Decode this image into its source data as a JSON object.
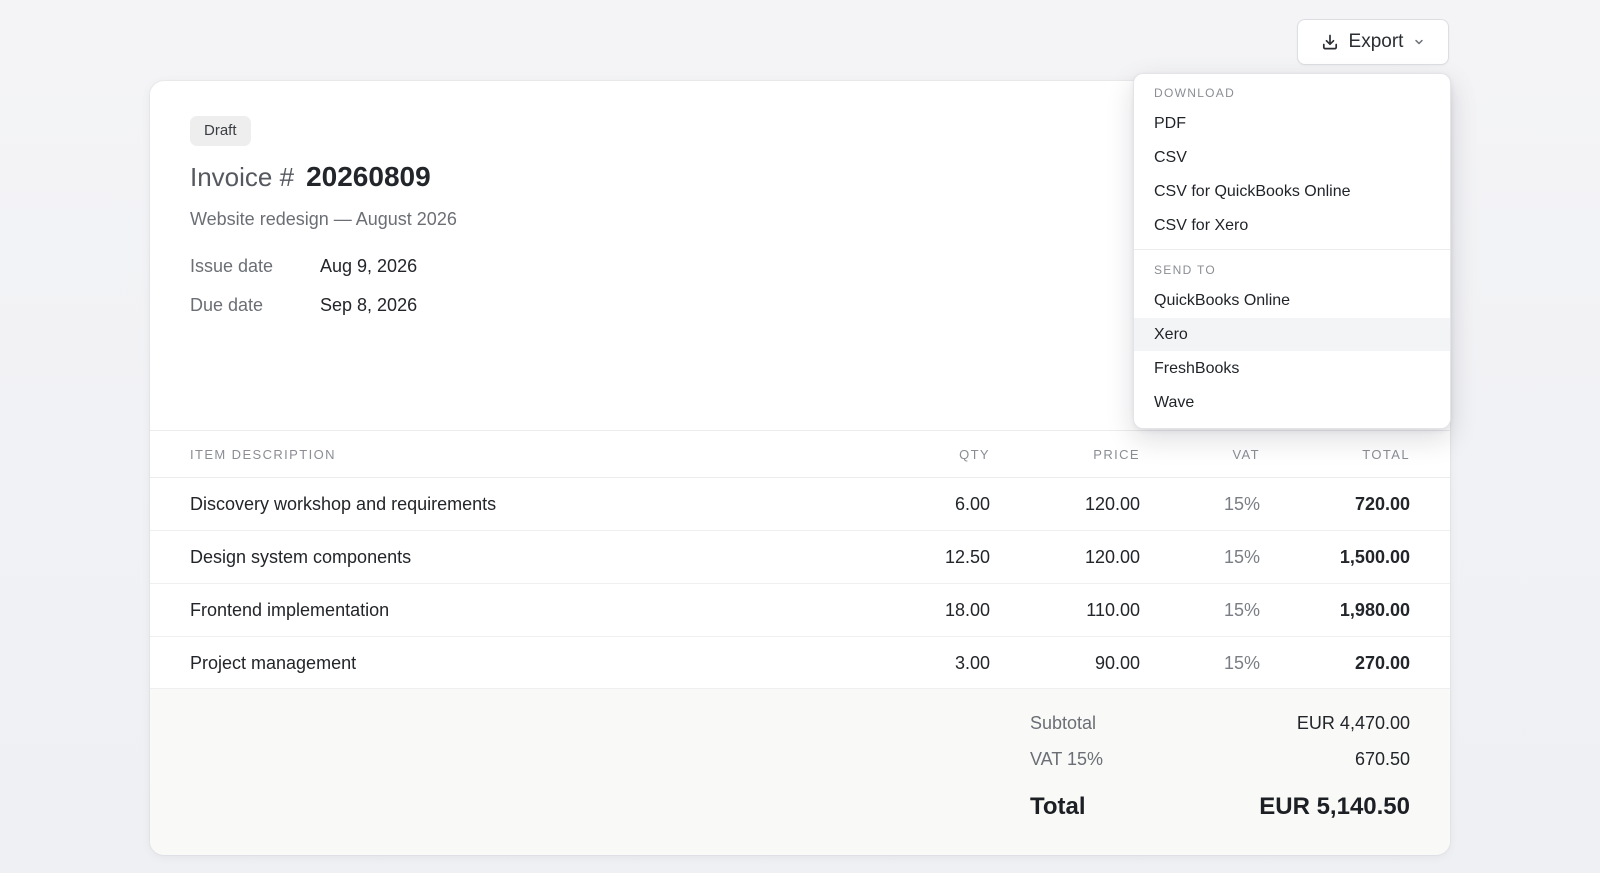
{
  "export_button": {
    "label": "Export",
    "icon": "download-icon",
    "chevron_icon": "chevron-down-icon"
  },
  "invoice": {
    "status": "Draft",
    "title_prefix": "Invoice #",
    "number": "20260809",
    "subtitle": "Website redesign — August 2026",
    "meta": [
      {
        "label": "Issue date",
        "value": "Aug 9, 2026"
      },
      {
        "label": "Due date",
        "value": "Sep 8, 2026"
      }
    ]
  },
  "table": {
    "headers": {
      "description": "ITEM DESCRIPTION",
      "qty": "QTY",
      "price": "PRICE",
      "vat": "VAT",
      "total": "TOTAL"
    },
    "rows": [
      {
        "description": "Discovery workshop and requirements",
        "qty": "6.00",
        "price": "120.00",
        "vat": "15%",
        "total": "720.00"
      },
      {
        "description": "Design system components",
        "qty": "12.50",
        "price": "120.00",
        "vat": "15%",
        "total": "1,500.00"
      },
      {
        "description": "Frontend implementation",
        "qty": "18.00",
        "price": "110.00",
        "vat": "15%",
        "total": "1,980.00"
      },
      {
        "description": "Project management",
        "qty": "3.00",
        "price": "90.00",
        "vat": "15%",
        "total": "270.00"
      }
    ]
  },
  "summary": {
    "subtotal_label": "Subtotal",
    "subtotal_value": "EUR 4,470.00",
    "vat_label": "VAT 15%",
    "vat_value": "670.50",
    "total_label": "Total",
    "total_value": "EUR 5,140.50"
  },
  "dropdown": {
    "download_label": "DOWNLOAD",
    "download_items": [
      "PDF",
      "CSV",
      "CSV for QuickBooks Online",
      "CSV for Xero"
    ],
    "send_label": "SEND TO",
    "send_items": [
      "QuickBooks Online",
      "Xero",
      "FreshBooks",
      "Wave"
    ],
    "hovered_item": "Xero"
  }
}
